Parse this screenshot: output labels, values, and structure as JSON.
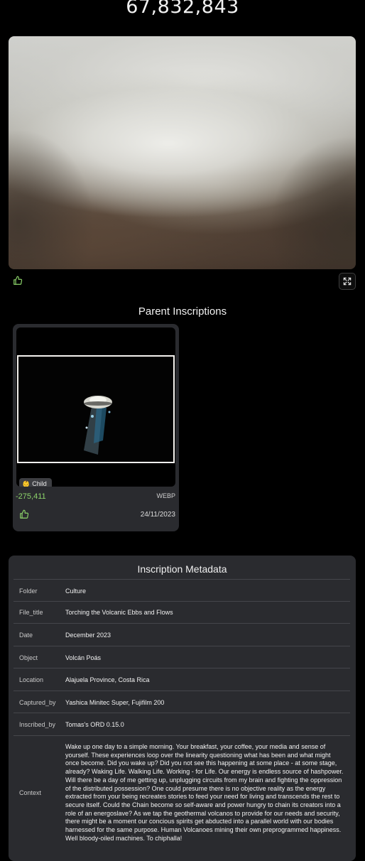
{
  "inscription": {
    "number": "67,832,843"
  },
  "actions": {
    "like_icon": "thumbs-up-icon",
    "expand_icon": "expand-icon",
    "accent_color": "#8cd36a"
  },
  "parents": {
    "title": "Parent Inscriptions",
    "items": [
      {
        "badge_icon": "baby-emoji",
        "badge_glyph": "👶",
        "badge_label": "Child",
        "number": "-275,411",
        "type": "WEBP",
        "date": "24/11/2023"
      }
    ]
  },
  "metadata": {
    "title": "Inscription Metadata",
    "rows": [
      {
        "key": "Folder",
        "value": "Culture"
      },
      {
        "key": "File_title",
        "value": "Torching the Volcanic Ebbs and Flows"
      },
      {
        "key": "Date",
        "value": "December 2023"
      },
      {
        "key": "Object",
        "value": "Volcán Poás"
      },
      {
        "key": "Location",
        "value": "Alajuela Province, Costa Rica"
      },
      {
        "key": "Captured_by",
        "value": "Yashica Minitec Super, Fujifilm 200"
      },
      {
        "key": "Inscribed_by",
        "value": "Tomas's ORD 0.15.0"
      },
      {
        "key": "Context",
        "value": "Wake up one day to a simple morning. Your breakfast, your coffee, your media and sense of yourself. These experiences loop over the linearity questioning what has been and what might once become. Did you wake up? Did you not see this happening at some place - at some stage, already? Waking Life. Walking Life. Working - for Life. Our energy is endless source of hashpower. Will there be a day of me getting up, unplugging circuits from my brain and fighting the oppression of the distributed possession? One could presume there is no objective reality as the energy extracted from your being recreates stories to feed your need for living and transcends the rest to secure itself. Could the Chain become so self-aware and power hungry to chain its creators into a role of an energoslave? As we tap the geothermal volcanos to provide for our needs and security, there might be a moment our concious spirits get abducted into a parallel world with our bodies harnessed for the same purpose. Human Volcanoes mining their own preprogrammed happiness. Well bloody-oiled machines. To chiphalla!"
      }
    ]
  }
}
